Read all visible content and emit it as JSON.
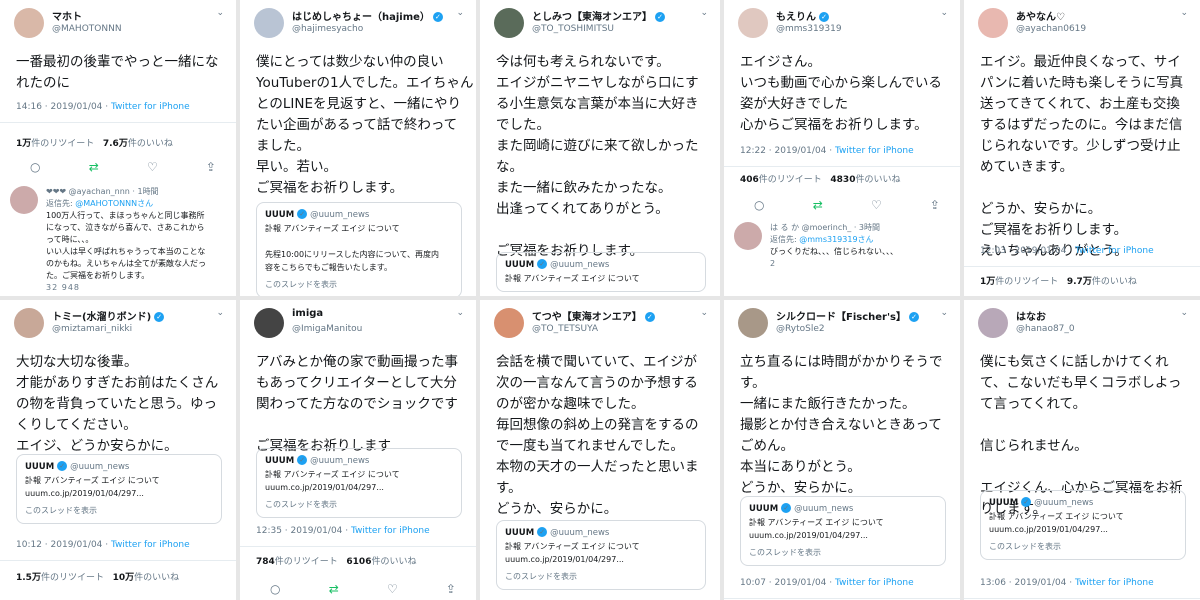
{
  "tweets": [
    {
      "name": "マホト",
      "verified": false,
      "handle": "@MAHOTONNN",
      "lines": [
        "一番最初の後輩でやっと一緒にな",
        "れたのに"
      ],
      "time": "14:16 · 2019/01/04 · ",
      "via": "Twitter for iPhone",
      "rt_num": "1万",
      "rt_label": "件のリツイート",
      "like_num": "7.6万",
      "like_label": "件のいいね",
      "reply": {
        "header": "❤❤❤ @ayachan_nnn · 1時間",
        "to_prefix": "返信先: ",
        "to": "@MAHOTONNNさん",
        "lines": [
          "100万人行って、まほっちゃんと同じ事務所",
          "になって、泣きながら喜んで、さあこれから",
          "って時に、、。",
          "いい人は早く呼ばれちゃうって本当のことな",
          "のかもね。えいちゃんは全てが素敵な人だっ",
          "た。ご冥福をお祈りします。"
        ],
        "counts": "32   948"
      }
    },
    {
      "name": "はじめしゃちょー（hajime）",
      "verified": true,
      "handle": "@hajimesyacho",
      "lines": [
        "僕にとっては数少ない仲の良い",
        "YouTuberの1人でした。エイちゃん",
        "とのLINEを見返すと、一緒にやり",
        "たい企画があるって話で終わって",
        "ました。",
        "早い。若い。",
        "ご冥福をお祈りします。"
      ],
      "quote": {
        "name": "UUUM",
        "handle": "@uuum_news",
        "lines": [
          "訃報 アバンティーズ エイジ について",
          "",
          "先程10:00にリリースした内容について、再度内",
          "容をこちらでもご報告いたします。"
        ],
        "show": "このスレッドを表示"
      }
    },
    {
      "name": "としみつ【東海オンエア】",
      "verified": true,
      "handle": "@TO_TOSHIMITSU",
      "lines": [
        "今は何も考えられないです。",
        "エイジがニヤニヤしながら口にす",
        "る小生意気な言葉が本当に大好き",
        "でした。",
        "また岡崎に遊びに来て欲しかった",
        "な。",
        "また一緒に飲みたかったな。",
        "出逢ってくれてありがとう。",
        "",
        "ご冥福をお祈りします。"
      ],
      "quote": {
        "name": "UUUM",
        "handle": "@uuum_news",
        "lines": [
          "訃報 アバンティーズ エイジ について"
        ],
        "show": ""
      }
    },
    {
      "name": "もえりん",
      "verified": true,
      "handle": "@mms319319",
      "lines": [
        "エイジさん。",
        "いつも動画で心から楽しんでいる",
        "姿が大好きでした",
        "心からご冥福をお祈りします。"
      ],
      "time": "12:22 · 2019/01/04 · ",
      "via": "Twitter for iPhone",
      "rt_num": "406",
      "rt_label": "件のリツイート",
      "like_num": "4830",
      "like_label": "件のいいね",
      "reply": {
        "header": "は る か @moerinch_ · 3時間",
        "to_prefix": "返信先: ",
        "to": "@mms319319さん",
        "lines": [
          "びっくりだね、、、信じられない、、、"
        ],
        "counts": "2"
      }
    },
    {
      "name": "あやなん♡",
      "verified": false,
      "handle": "@ayachan0619",
      "lines": [
        "エイジ。最近仲良くなって、サイ",
        "パンに着いた時も楽しそうに写真",
        "送ってきてくれて、お土産も交換",
        "するはずだったのに。今はまだ信",
        "じられないです。少しずつ受け止",
        "めていきます。",
        "",
        "どうか、安らかに。",
        "ご冥福をお祈りします。",
        "えいちゃんありがとう。"
      ],
      "time": "12:03 · 2019/01/04 · ",
      "via": "Twitter for iPhone",
      "rt_num": "1万",
      "rt_label": "件のリツイート",
      "like_num": "9.7万",
      "like_label": "件のいいね"
    },
    {
      "name": "トミー(水溜りボンド)",
      "verified": true,
      "handle": "@miztamari_nikki",
      "lines": [
        "大切な大切な後輩。",
        "才能がありすぎたお前はたくさん",
        "の物を背負っていたと思う。ゆっ",
        "くりしてください。",
        "エイジ、どうか安らかに。"
      ],
      "quote": {
        "name": "UUUM",
        "handle": "@uuum_news",
        "lines": [
          "訃報 アバンティーズ エイジ について",
          "uuum.co.jp/2019/01/04/297..."
        ],
        "show": "このスレッドを表示"
      },
      "time": "10:12 · 2019/01/04 · ",
      "via": "Twitter for iPhone",
      "rt_num": "1.5万",
      "rt_label": "件のリツイート",
      "like_num": "10万",
      "like_label": "件のいいね"
    },
    {
      "name": "imiga",
      "verified": false,
      "handle": "@ImigaManitou",
      "lines": [
        "アバみとか俺の家で動画撮った事",
        "もあってクリエイターとして大分",
        "関わってた方なのでショックです",
        "",
        "ご冥福をお祈りします"
      ],
      "quote": {
        "name": "UUUM",
        "handle": "@uuum_news",
        "lines": [
          "訃報 アバンティーズ エイジ について",
          "uuum.co.jp/2019/01/04/297..."
        ],
        "show": "このスレッドを表示"
      },
      "time": "12:35 · 2019/01/04 · ",
      "via": "Twitter for iPhone",
      "rt_num": "784",
      "rt_label": "件のリツイート",
      "like_num": "6106",
      "like_label": "件のいいね"
    },
    {
      "name": "てつや【東海オンエア】",
      "verified": true,
      "handle": "@TO_TETSUYA",
      "lines": [
        "会話を横で聞いていて、エイジが",
        "次の一言なんて言うのか予想する",
        "のが密かな趣味でした。",
        "毎回想像の斜め上の発言をするの",
        "で一度も当てれませんでした。",
        "本物の天才の一人だったと思いま",
        "す。",
        "どうか、安らかに。"
      ],
      "quote": {
        "name": "UUUM",
        "handle": "@uuum_news",
        "lines": [
          "訃報 アバンティーズ エイジ について",
          "uuum.co.jp/2019/01/04/297..."
        ],
        "show": "このスレッドを表示"
      }
    },
    {
      "name": "シルクロード【Fischer's】",
      "verified": true,
      "handle": "@RytoSle2",
      "lines": [
        "立ち直るには時間がかかりそうで",
        "す。",
        "一緒にまた飯行きたかった。",
        "撮影とか付き合えないときあって",
        "ごめん。",
        "本当にありがとう。",
        "どうか、安らかに。"
      ],
      "quote": {
        "name": "UUUM",
        "handle": "@uuum_news",
        "lines": [
          "訃報 アバンティーズ エイジ について",
          "uuum.co.jp/2019/01/04/297..."
        ],
        "show": "このスレッドを表示"
      },
      "time": "10:07 · 2019/01/04 · ",
      "via": "Twitter for iPhone"
    },
    {
      "name": "はなお",
      "verified": false,
      "handle": "@hanao87_0",
      "lines": [
        "僕にも気さくに話しかけてくれ",
        "て、こないだも早くコラボしよっ",
        "て言ってくれて。",
        "",
        "信じられません。",
        "",
        "エイジくん、心からご冥福をお祈",
        "りします。"
      ],
      "quote": {
        "name": "UUUM",
        "handle": "@uuum_news",
        "lines": [
          "訃報 アバンティーズ エイジ について",
          "uuum.co.jp/2019/01/04/297..."
        ],
        "show": "このスレッドを表示"
      },
      "time": "13:06 · 2019/01/04 · ",
      "via": "Twitter for iPhone"
    }
  ],
  "icons": {
    "reply": "reply-icon",
    "retweet": "retweet-icon",
    "like": "heart-icon",
    "share": "share-icon",
    "verified": "verified-badge-icon",
    "chevron": "chevron-down-icon"
  }
}
